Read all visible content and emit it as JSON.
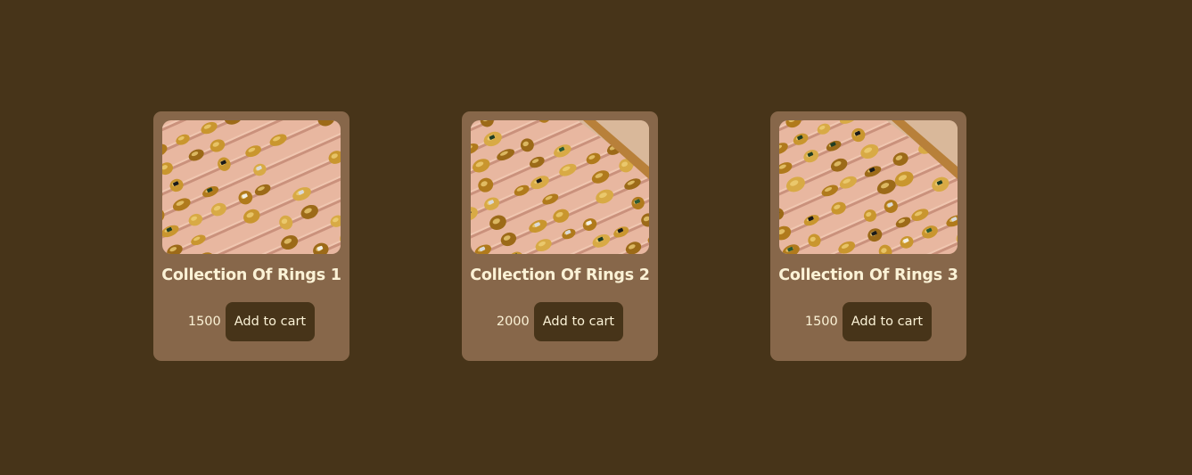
{
  "products": [
    {
      "name": "Collection Of Rings 1",
      "price": "1500",
      "cart_label": "Add to cart"
    },
    {
      "name": "Collection Of Rings 2",
      "price": "2000",
      "cart_label": "Add to cart"
    },
    {
      "name": "Collection Of Rings 3",
      "price": "1500",
      "cart_label": "Add to cart"
    }
  ],
  "colors": {
    "page_background": "#473419",
    "card_background": "#87674a",
    "button_background": "#473419",
    "text": "#fbf2d6"
  }
}
